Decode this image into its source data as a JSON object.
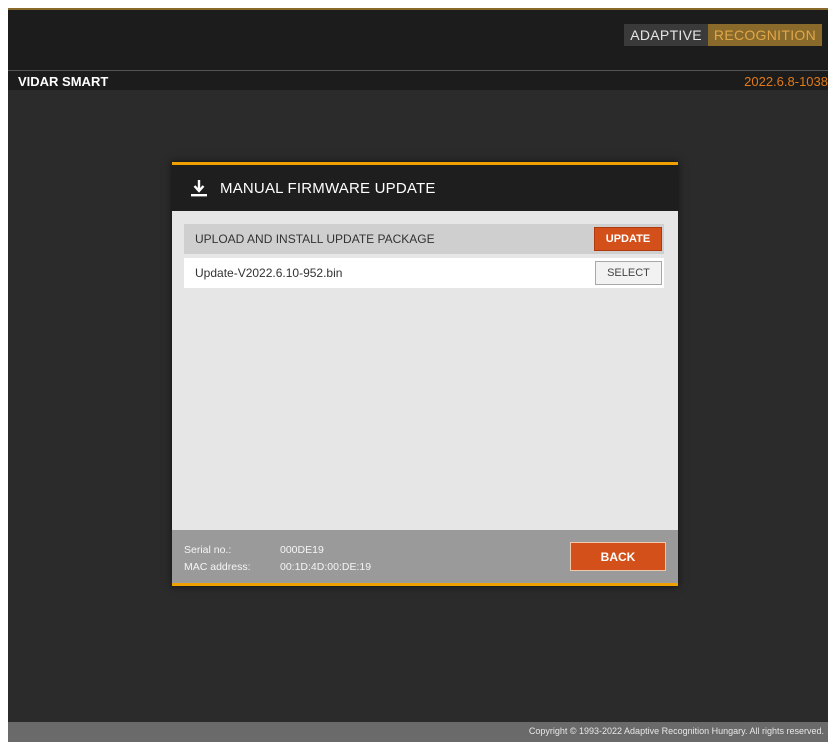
{
  "header": {
    "brand_left": "ADAPTIVE",
    "brand_right": "RECOGNITION",
    "app_title": "VIDAR SMART",
    "version": "2022.6.8-1038"
  },
  "dialog": {
    "icon": "download-icon",
    "title": "MANUAL FIRMWARE UPDATE",
    "section_label": "UPLOAD AND INSTALL UPDATE PACKAGE",
    "update_label": "UPDATE",
    "file_name": "Update-V2022.6.10-952.bin",
    "select_label": "SELECT",
    "serial_label": "Serial no.:",
    "serial_value": "000DE19",
    "mac_label": "MAC address:",
    "mac_value": "00:1D:4D:00:DE:19",
    "back_label": "BACK"
  },
  "footer": {
    "copyright": "Copyright © 1993-2022 Adaptive Recognition Hungary. All rights reserved."
  },
  "colors": {
    "accent_orange": "#d4501a",
    "dialog_border": "#f0a000",
    "brand_gold": "#8a6a2a",
    "version_orange": "#e07a1a"
  }
}
